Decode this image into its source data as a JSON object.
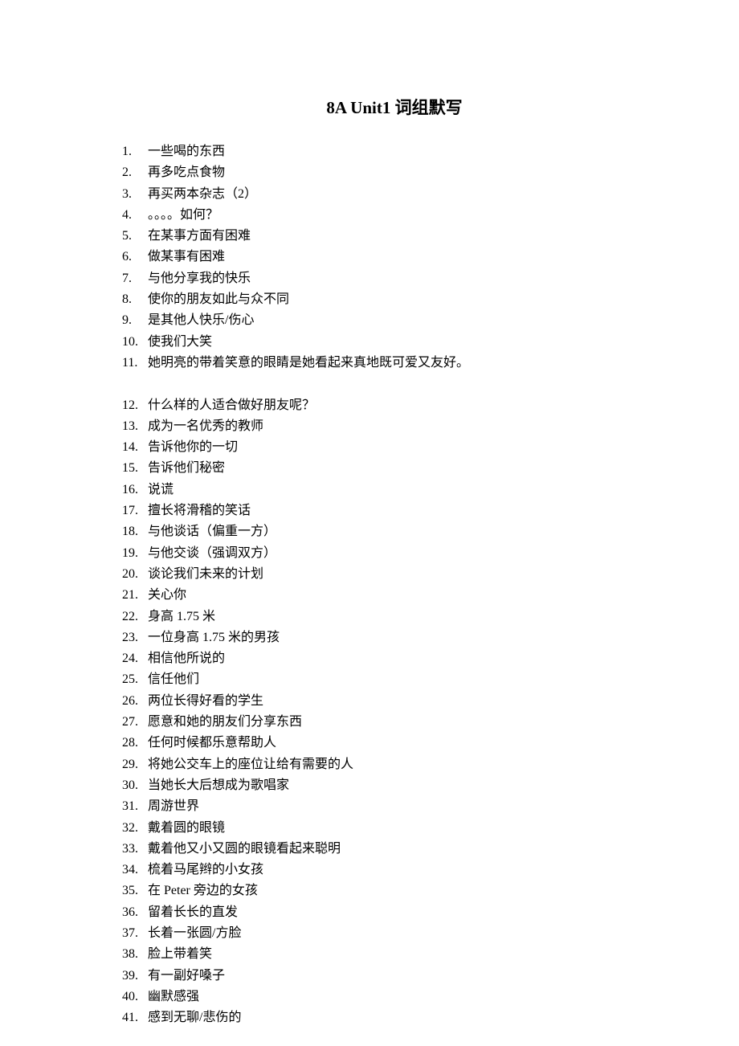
{
  "title": "8A Unit1 词组默写",
  "items": [
    "一些喝的东西",
    "再多吃点食物",
    "再买两本杂志（2）",
    "。。。。如何？",
    "在某事方面有困难",
    "做某事有困难",
    "与他分享我的快乐",
    "使你的朋友如此与众不同",
    "是其他人快乐/伤心",
    "使我们大笑",
    "她明亮的带着笑意的眼睛是她看起来真地既可爱又友好。",
    "什么样的人适合做好朋友呢？",
    "成为一名优秀的教师",
    "告诉他你的一切",
    "告诉他们秘密",
    "说谎",
    "擅长将滑稽的笑话",
    "与他谈话（偏重一方）",
    "与他交谈（强调双方）",
    "谈论我们未来的计划",
    "关心你",
    "身高 1.75 米",
    "一位身高 1.75 米的男孩",
    "相信他所说的",
    "信任他们",
    "两位长得好看的学生",
    "愿意和她的朋友们分享东西",
    "任何时候都乐意帮助人",
    "将她公交车上的座位让给有需要的人",
    "当她长大后想成为歌唱家",
    "周游世界",
    "戴着圆的眼镜",
    "戴着他又小又圆的眼镜看起来聪明",
    "梳着马尾辫的小女孩",
    "在 Peter 旁边的女孩",
    "留着长长的直发",
    "长着一张圆/方脸",
    "脸上带着笑",
    "有一副好嗓子",
    "幽默感强",
    "感到无聊/悲伤的"
  ],
  "blank_after_index": 10
}
